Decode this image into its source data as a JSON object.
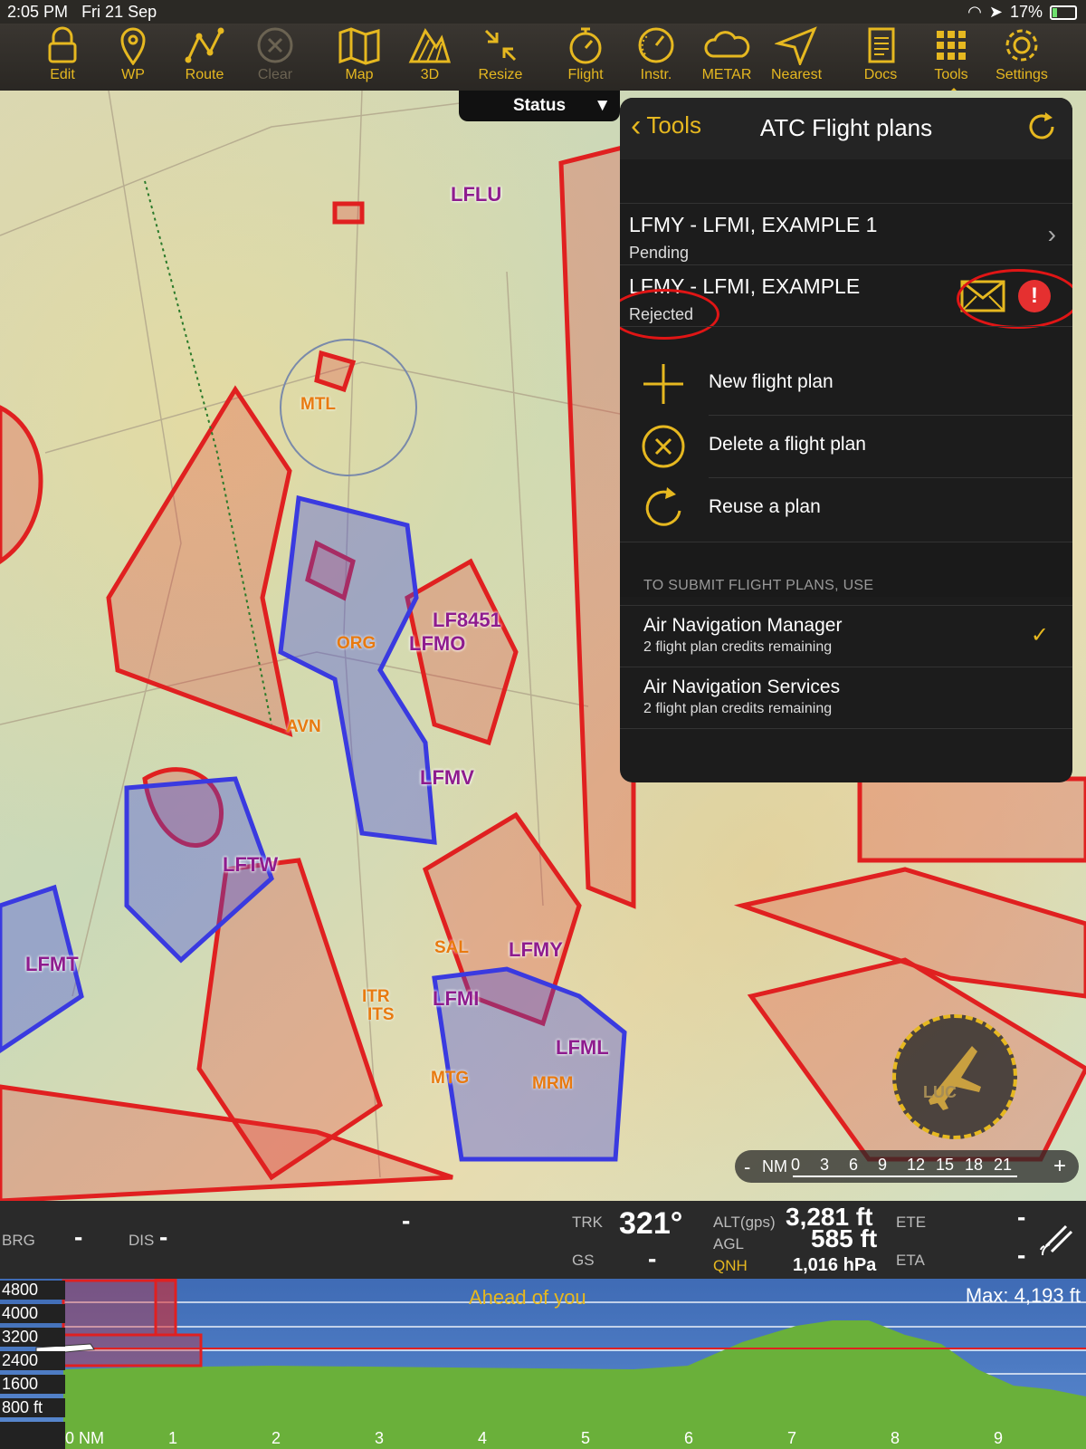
{
  "status_bar": {
    "time": "2:05 PM",
    "date": "Fri 21 Sep",
    "battery": "17%"
  },
  "toolbar": [
    {
      "label": "Edit",
      "icon": "lock-icon"
    },
    {
      "label": "WP",
      "icon": "pin-icon"
    },
    {
      "label": "Route",
      "icon": "route-icon"
    },
    {
      "label": "Clear",
      "icon": "clear-icon"
    },
    {
      "label": "Map",
      "icon": "map-icon"
    },
    {
      "label": "3D",
      "icon": "terrain-icon"
    },
    {
      "label": "Resize",
      "icon": "resize-icon"
    },
    {
      "label": "Flight",
      "icon": "stopwatch-icon"
    },
    {
      "label": "Instr.",
      "icon": "gauge-icon"
    },
    {
      "label": "METAR",
      "icon": "cloud-icon"
    },
    {
      "label": "Nearest",
      "icon": "nearest-icon"
    },
    {
      "label": "Docs",
      "icon": "docs-icon"
    },
    {
      "label": "Tools",
      "icon": "tools-grid-icon"
    },
    {
      "label": "Settings",
      "icon": "gear-icon"
    }
  ],
  "status_tab": "Status",
  "panel": {
    "back_label": "Tools",
    "title": "ATC Flight plans",
    "flight_plans": [
      {
        "title": "LFMY - LFMI, EXAMPLE 1",
        "status": "Pending"
      },
      {
        "title": "LFMY - LFMI, EXAMPLE",
        "status": "Rejected"
      }
    ],
    "actions": [
      "New flight plan",
      "Delete a flight plan",
      "Reuse a plan"
    ],
    "submit_header": "TO SUBMIT FLIGHT PLANS, USE",
    "services": [
      {
        "name": "Air Navigation Manager",
        "credits": "2 flight plan credits remaining",
        "selected": true
      },
      {
        "name": "Air Navigation Services",
        "credits": "2 flight plan credits remaining",
        "selected": false
      }
    ]
  },
  "map_labels": {
    "airports": [
      "LFLU",
      "LF8451",
      "LFMO",
      "LFMV",
      "LFTW",
      "LFMT",
      "LFMY",
      "LFMI",
      "LFML"
    ],
    "navaids": [
      "MTL",
      "ORG",
      "AVN",
      "SAL",
      "ITR",
      "ITS",
      "MTG",
      "MRM"
    ],
    "ap_marker": "LUC"
  },
  "scale": {
    "unit": "NM",
    "minus": "-",
    "plus": "+",
    "ticks": [
      "0",
      "3",
      "6",
      "9",
      "12",
      "15",
      "18",
      "21"
    ]
  },
  "info": {
    "brg_label": "BRG",
    "brg_value": "-",
    "dis_label": "DIS",
    "dis_value": "-",
    "center_value": "-",
    "trk_label": "TRK",
    "trk_value": "321°",
    "gs_label": "GS",
    "gs_value": "-",
    "alt_label": "ALT(gps)",
    "alt_value": "3,281 ft",
    "agl_label": "AGL",
    "agl_value": "585 ft",
    "qnh_label": "QNH",
    "qnh_value": "1,016 hPa",
    "ete_label": "ETE",
    "ete_value": "-",
    "eta_label": "ETA",
    "eta_value": "-"
  },
  "profile": {
    "ahead": "Ahead of you",
    "max": "Max: 4,193 ft",
    "y_ticks": [
      "4800",
      "4000",
      "3200",
      "2400",
      "1600",
      "800 ft"
    ],
    "x_ticks": [
      "0 NM",
      "1",
      "2",
      "3",
      "4",
      "5",
      "6",
      "7",
      "8",
      "9"
    ]
  }
}
